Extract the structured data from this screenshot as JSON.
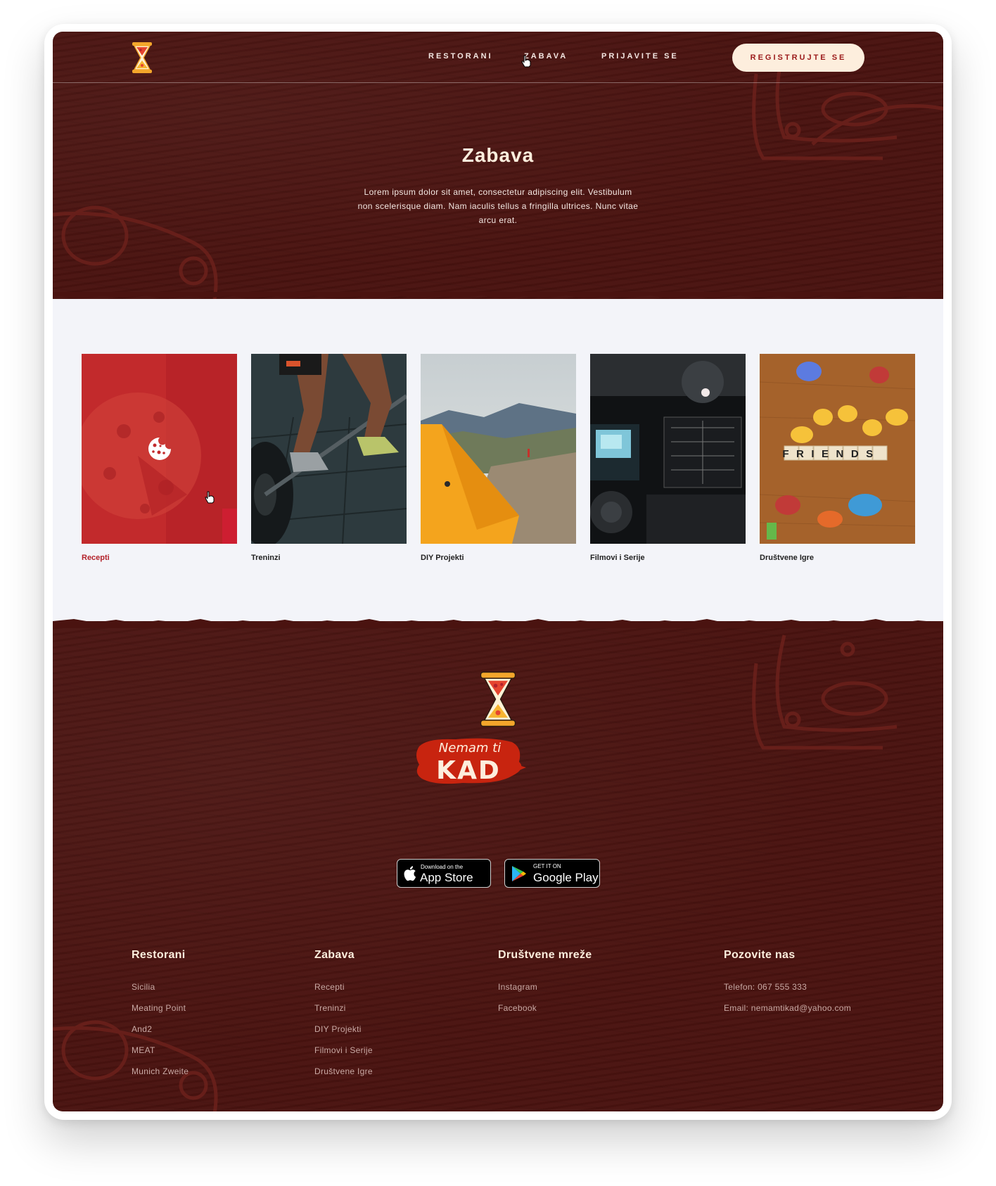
{
  "nav": {
    "links": [
      "RESTORANI",
      "ZABAVA",
      "PRIJAVITE SE"
    ],
    "cta": "REGISTRUJTE SE"
  },
  "hero": {
    "title": "Zabava",
    "text": "Lorem ipsum dolor sit amet, consectetur adipiscing elit. Vestibulum non scelerisque diam. Nam iaculis tellus a fringilla ultrices. Nunc vitae arcu erat."
  },
  "categories": [
    {
      "label": "Recepti",
      "active": true,
      "icon": "cookie-icon"
    },
    {
      "label": "Treninzi",
      "active": false
    },
    {
      "label": "DIY Projekti",
      "active": false
    },
    {
      "label": "Filmovi i Serije",
      "active": false
    },
    {
      "label": "Društvene Igre",
      "active": false
    }
  ],
  "photo_text": {
    "friends": "FRIENDS"
  },
  "brand": {
    "line1": "Nemam ti",
    "line2": "KAD"
  },
  "stores": {
    "apple_small": "Download on the",
    "apple_big": "App Store",
    "google_small": "GET IT ON",
    "google_big": "Google Play"
  },
  "footer": {
    "columns": [
      {
        "title": "Restorani",
        "links": [
          "Sicilia",
          "Meating Point",
          "And2",
          "MEAT",
          "Munich Zweite"
        ]
      },
      {
        "title": "Zabava",
        "links": [
          "Recepti",
          "Treninzi",
          "DIY Projekti",
          "Filmovi i Serije",
          "Društvene Igre"
        ]
      },
      {
        "title": "Društvene mreže",
        "links": [
          "Instagram",
          "Facebook"
        ]
      },
      {
        "title": "Pozovite nas",
        "links": [
          "Telefon: 067 555 333",
          "Email: nemamtikad@yahoo.com"
        ]
      }
    ]
  },
  "colors": {
    "maroon": "#4a1310",
    "cream": "#fdeedd",
    "accent_red": "#b3222a",
    "light_bg": "#f3f4f9"
  }
}
